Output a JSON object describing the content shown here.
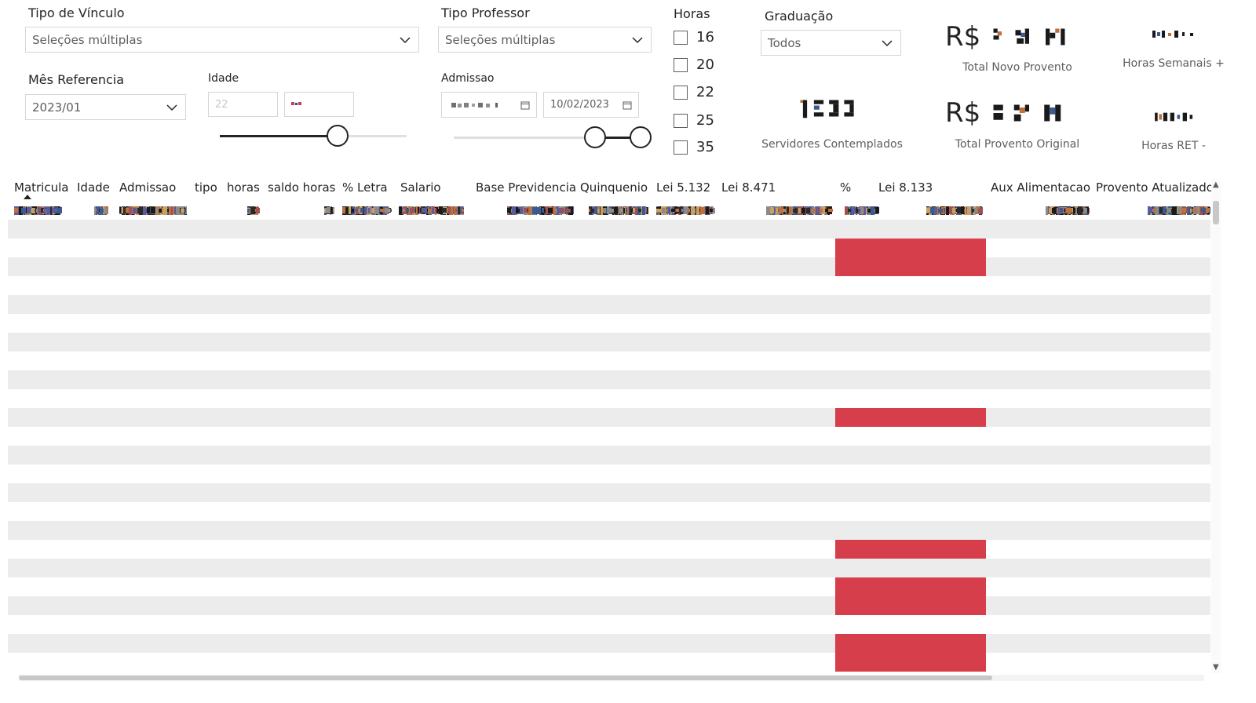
{
  "filters": {
    "tipo_vinculo": {
      "label": "Tipo de Vínculo",
      "value": "Seleções múltiplas"
    },
    "tipo_professor": {
      "label": "Tipo Professor",
      "value": "Seleções múltiplas"
    },
    "mes_referencia": {
      "label": "Mês Referencia",
      "value": "2023/01"
    },
    "idade": {
      "label": "Idade",
      "min_value": "22"
    },
    "admissao": {
      "label": "Admissao",
      "end_value": "10/02/2023"
    },
    "horas": {
      "label": "Horas",
      "options": [
        "16",
        "20",
        "22",
        "25",
        "35"
      ]
    },
    "graduacao": {
      "label": "Graduação",
      "value": "Todos"
    }
  },
  "cards": {
    "total_novo_provento": {
      "label": "Total Novo Provento",
      "prefix": "R$"
    },
    "total_provento_original": {
      "label": "Total Provento Original",
      "prefix": "R$"
    },
    "servidores_contemplados": {
      "label": "Servidores Contemplados"
    },
    "horas_semanais": {
      "label": "Horas Semanais +"
    },
    "horas_ret": {
      "label": "Horas RET -"
    }
  },
  "table": {
    "columns": [
      "Matricula",
      "Idade",
      "Admissao",
      "tipo",
      "horas",
      "saldo horas",
      "% Letra",
      "Salario",
      "Base Previdencia",
      "Quinquenio",
      "Lei 5.132",
      "Lei 8.471",
      "%",
      "Lei 8.133",
      "Aux Alimentacao",
      "Provento Atualizado"
    ],
    "sorted_column": "Matricula",
    "row_count": 25,
    "highlight_color": "#d63e4b"
  }
}
